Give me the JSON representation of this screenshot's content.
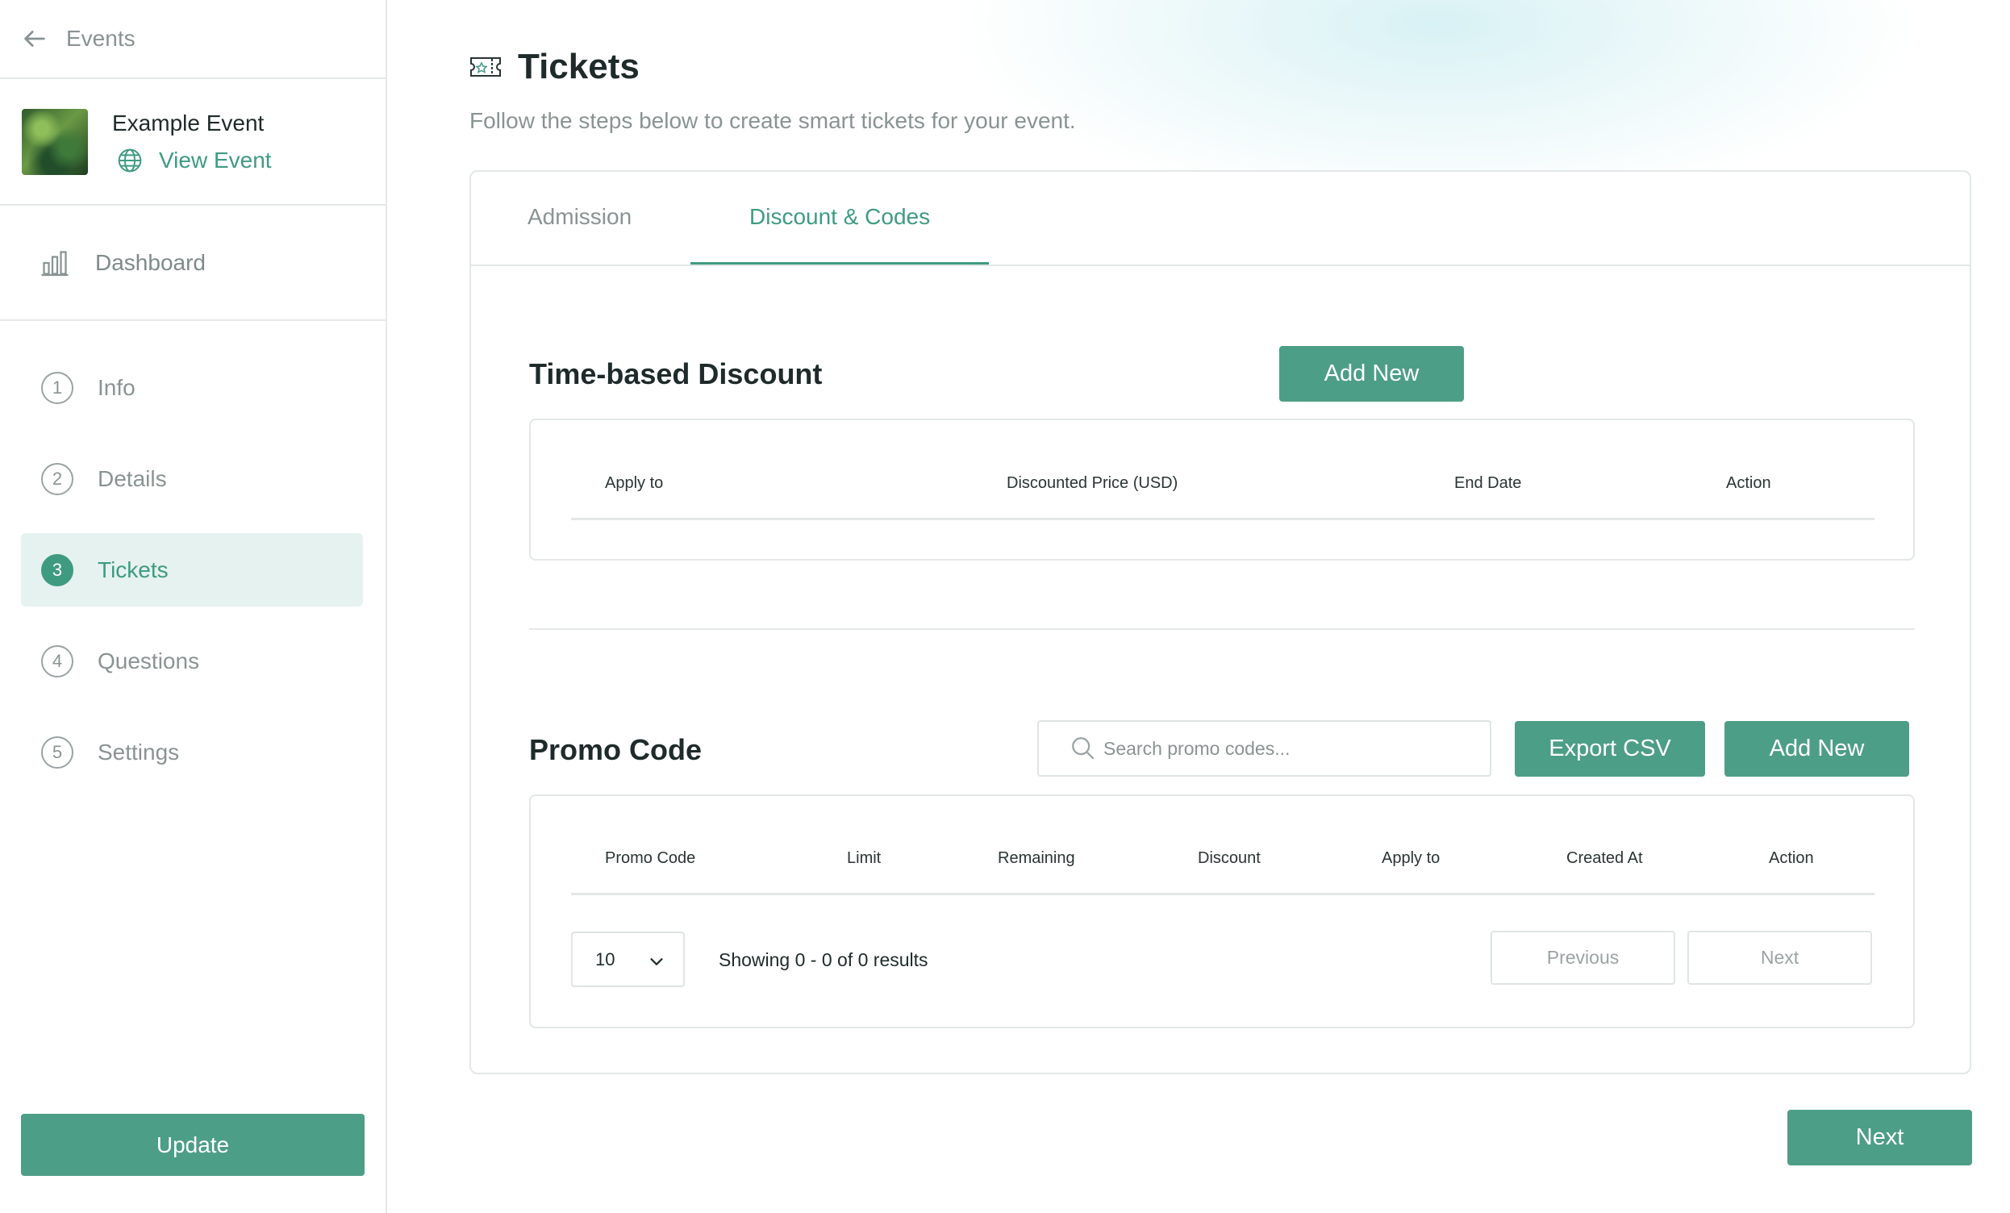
{
  "sidebar": {
    "back_label": "Events",
    "event_title": "Example Event",
    "view_event_label": "View Event",
    "dashboard_label": "Dashboard",
    "steps": [
      {
        "num": "1",
        "label": "Info"
      },
      {
        "num": "2",
        "label": "Details"
      },
      {
        "num": "3",
        "label": "Tickets"
      },
      {
        "num": "4",
        "label": "Questions"
      },
      {
        "num": "5",
        "label": "Settings"
      }
    ],
    "update_label": "Update"
  },
  "page": {
    "title": "Tickets",
    "subtitle": "Follow the steps below to create smart tickets for your event."
  },
  "tabs": [
    {
      "label": "Admission"
    },
    {
      "label": "Discount & Codes"
    }
  ],
  "time_discount": {
    "title": "Time-based Discount",
    "add_label": "Add New",
    "columns": [
      "Apply to",
      "Discounted Price (USD)",
      "End Date",
      "Action"
    ]
  },
  "promo": {
    "title": "Promo Code",
    "search_placeholder": "Search promo codes...",
    "export_label": "Export CSV",
    "add_label": "Add New",
    "columns": [
      "Promo Code",
      "Limit",
      "Remaining",
      "Discount",
      "Apply to",
      "Created At",
      "Action"
    ],
    "page_size": "10",
    "showing": "Showing 0 - 0 of 0 results",
    "prev_label": "Previous",
    "next_label": "Next"
  },
  "footer": {
    "next_label": "Next"
  },
  "colors": {
    "accent": "#4d9e86",
    "active_bg": "#e6f2ef",
    "muted": "#8a9393"
  }
}
